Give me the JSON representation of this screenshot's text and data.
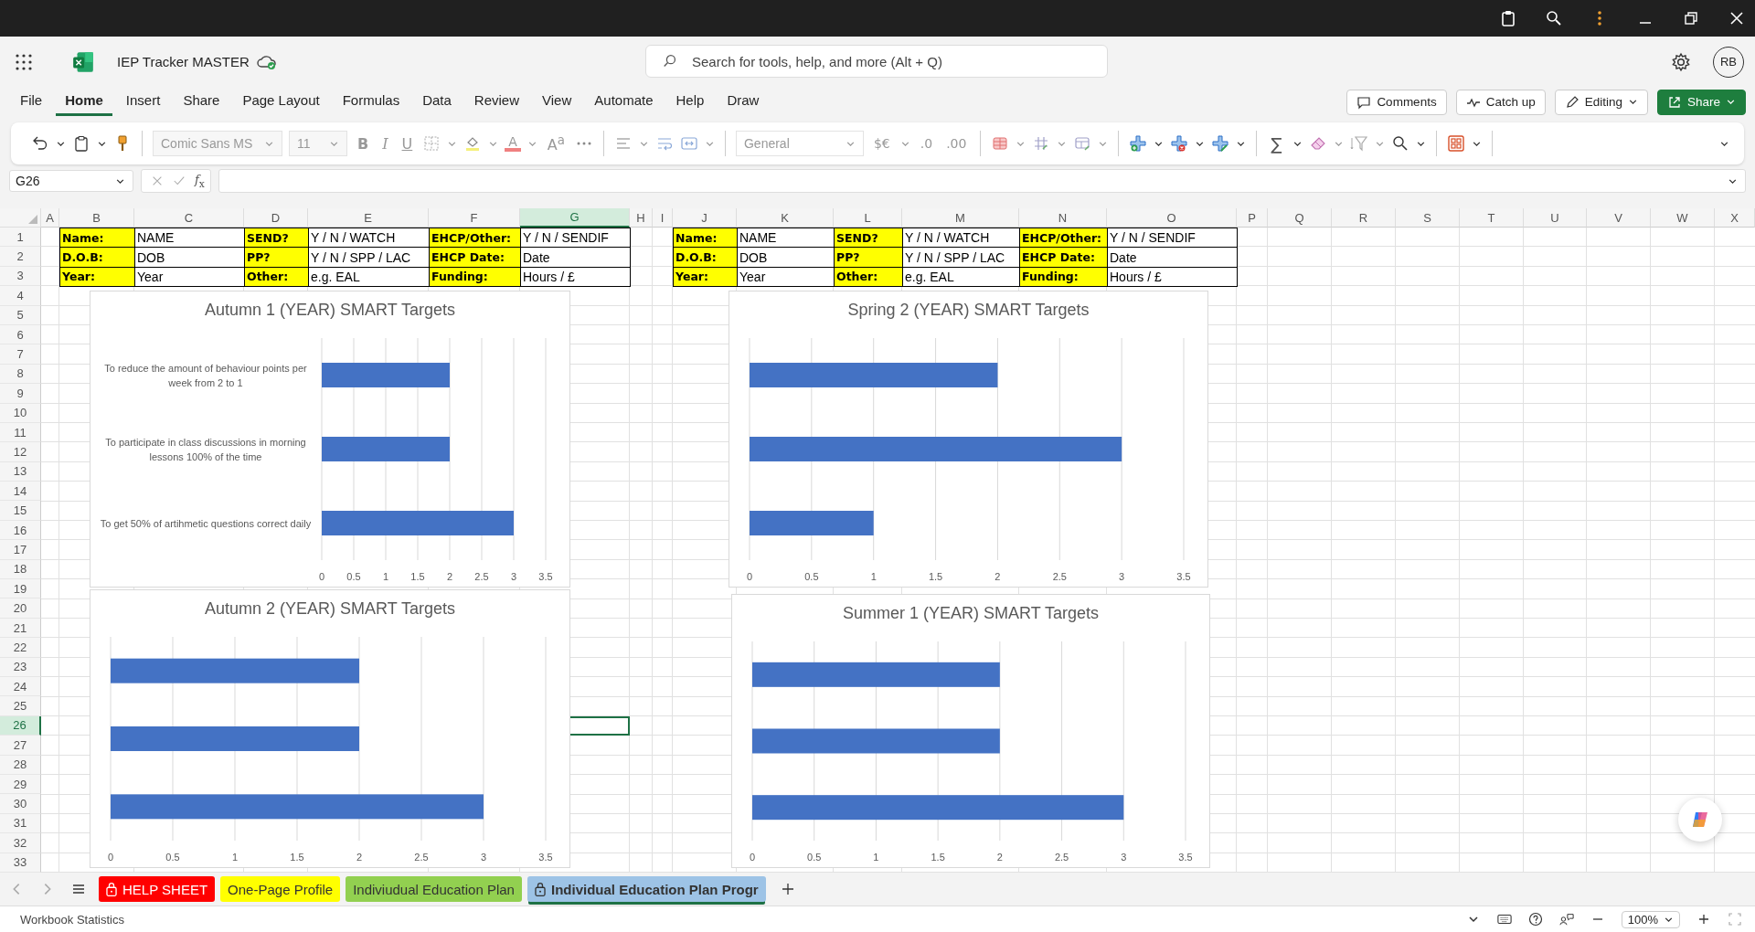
{
  "app": {
    "title": "IEP Tracker MASTER",
    "search": {
      "placeholder": "Search for tools, help, and more (Alt + Q)"
    },
    "avatar": "RB"
  },
  "menu_tabs": [
    {
      "label": "File",
      "selected": false
    },
    {
      "label": "Home",
      "selected": true
    },
    {
      "label": "Insert",
      "selected": false
    },
    {
      "label": "Share",
      "selected": false
    },
    {
      "label": "Page Layout",
      "selected": false
    },
    {
      "label": "Formulas",
      "selected": false
    },
    {
      "label": "Data",
      "selected": false
    },
    {
      "label": "Review",
      "selected": false
    },
    {
      "label": "View",
      "selected": false
    },
    {
      "label": "Automate",
      "selected": false
    },
    {
      "label": "Help",
      "selected": false
    },
    {
      "label": "Draw",
      "selected": false
    }
  ],
  "actions": [
    {
      "label": "Comments",
      "kind": "comments"
    },
    {
      "label": "Catch up",
      "kind": "catchup"
    },
    {
      "label": "Editing",
      "kind": "editing"
    },
    {
      "label": "Share",
      "kind": "share"
    }
  ],
  "ribbon": {
    "font": "Comic Sans MS",
    "size": "11",
    "bold": "B",
    "italic": "I",
    "underline": "U",
    "font_color": "A",
    "grow_font": "A$^{a}$",
    "number_format": "General",
    "currency": "$€",
    "decrease_decimal": ".0",
    "increase_decimal": ".00",
    "sum": "∑"
  },
  "formula_bar": {
    "name_box": "G26",
    "fx": "*f*$_{x}$"
  },
  "columns": [
    {
      "label": "A",
      "selected": false
    },
    {
      "label": "B",
      "selected": false
    },
    {
      "label": "C",
      "selected": false
    },
    {
      "label": "D",
      "selected": false
    },
    {
      "label": "E",
      "selected": false
    },
    {
      "label": "F",
      "selected": false
    },
    {
      "label": "G",
      "selected": true
    },
    {
      "label": "H",
      "selected": false
    },
    {
      "label": "I",
      "selected": false
    },
    {
      "label": "J",
      "selected": false
    },
    {
      "label": "K",
      "selected": false
    },
    {
      "label": "L",
      "selected": false
    },
    {
      "label": "M",
      "selected": false
    },
    {
      "label": "N",
      "selected": false
    },
    {
      "label": "O",
      "selected": false
    },
    {
      "label": "P",
      "selected": false
    },
    {
      "label": "Q",
      "selected": false
    },
    {
      "label": "R",
      "selected": false
    },
    {
      "label": "S",
      "selected": false
    },
    {
      "label": "T",
      "selected": false
    },
    {
      "label": "U",
      "selected": false
    },
    {
      "label": "V",
      "selected": false
    },
    {
      "label": "W",
      "selected": false
    },
    {
      "label": "X",
      "selected": false
    }
  ],
  "rows": [
    {
      "label": "1",
      "selected": false
    },
    {
      "label": "2",
      "selected": false
    },
    {
      "label": "3",
      "selected": false
    },
    {
      "label": "4",
      "selected": false
    },
    {
      "label": "5",
      "selected": false
    },
    {
      "label": "6",
      "selected": false
    },
    {
      "label": "7",
      "selected": false
    },
    {
      "label": "8",
      "selected": false
    },
    {
      "label": "9",
      "selected": false
    },
    {
      "label": "10",
      "selected": false
    },
    {
      "label": "11",
      "selected": false
    },
    {
      "label": "12",
      "selected": false
    },
    {
      "label": "13",
      "selected": false
    },
    {
      "label": "14",
      "selected": false
    },
    {
      "label": "15",
      "selected": false
    },
    {
      "label": "16",
      "selected": false
    },
    {
      "label": "17",
      "selected": false
    },
    {
      "label": "18",
      "selected": false
    },
    {
      "label": "19",
      "selected": false
    },
    {
      "label": "20",
      "selected": false
    },
    {
      "label": "21",
      "selected": false
    },
    {
      "label": "22",
      "selected": false
    },
    {
      "label": "23",
      "selected": false
    },
    {
      "label": "24",
      "selected": false
    },
    {
      "label": "25",
      "selected": false
    },
    {
      "label": "26",
      "selected": true
    },
    {
      "label": "27",
      "selected": false
    },
    {
      "label": "28",
      "selected": false
    },
    {
      "label": "29",
      "selected": false
    },
    {
      "label": "30",
      "selected": false
    },
    {
      "label": "31",
      "selected": false
    },
    {
      "label": "32",
      "selected": false
    },
    {
      "label": "33",
      "selected": false
    }
  ],
  "info_tables": [
    {
      "rows": [
        [
          {
            "text": "Name:",
            "kind": "label"
          },
          {
            "text": "NAME",
            "kind": "value"
          },
          {
            "text": "SEND?",
            "kind": "label"
          },
          {
            "text": "Y / N / WATCH",
            "kind": "value"
          },
          {
            "text": "EHCP/Other:",
            "kind": "label"
          },
          {
            "text": "Y / N / SENDIF",
            "kind": "value"
          }
        ],
        [
          {
            "text": "D.O.B:",
            "kind": "label"
          },
          {
            "text": "DOB",
            "kind": "value"
          },
          {
            "text": "PP?",
            "kind": "label"
          },
          {
            "text": "Y / N / SPP / LAC",
            "kind": "value"
          },
          {
            "text": "EHCP Date:",
            "kind": "label"
          },
          {
            "text": "Date",
            "kind": "value"
          }
        ],
        [
          {
            "text": "Year:",
            "kind": "label"
          },
          {
            "text": "Year",
            "kind": "value"
          },
          {
            "text": "Other:",
            "kind": "label"
          },
          {
            "text": "e.g. EAL",
            "kind": "value"
          },
          {
            "text": "Funding:",
            "kind": "label"
          },
          {
            "text": "Hours / £",
            "kind": "value"
          }
        ]
      ]
    },
    {
      "rows": [
        [
          {
            "text": "Name:",
            "kind": "label"
          },
          {
            "text": "NAME",
            "kind": "value"
          },
          {
            "text": "SEND?",
            "kind": "label"
          },
          {
            "text": "Y / N / WATCH",
            "kind": "value"
          },
          {
            "text": "EHCP/Other:",
            "kind": "label"
          },
          {
            "text": "Y / N / SENDIF",
            "kind": "value"
          }
        ],
        [
          {
            "text": "D.O.B:",
            "kind": "label"
          },
          {
            "text": "DOB",
            "kind": "value"
          },
          {
            "text": "PP?",
            "kind": "label"
          },
          {
            "text": "Y / N / SPP / LAC",
            "kind": "value"
          },
          {
            "text": "EHCP Date:",
            "kind": "label"
          },
          {
            "text": "Date",
            "kind": "value"
          }
        ],
        [
          {
            "text": "Year:",
            "kind": "label"
          },
          {
            "text": "Year",
            "kind": "value"
          },
          {
            "text": "Other:",
            "kind": "label"
          },
          {
            "text": "e.g. EAL",
            "kind": "value"
          },
          {
            "text": "Funding:",
            "kind": "label"
          },
          {
            "text": "Hours / £",
            "kind": "value"
          }
        ]
      ]
    }
  ],
  "charts": [
    {
      "chart_data": {
        "type": "bar",
        "orientation": "horizontal",
        "title": "Autumn 1 (YEAR) SMART Targets",
        "categories": [
          "To reduce the amount of behaviour points per week from 2 to 1",
          "To participate in class discussions in morning lessons 100% of the time",
          "To get 50% of artihmetic questions correct daily"
        ],
        "values": [
          2,
          2,
          3
        ],
        "xlim": [
          0,
          3.5
        ],
        "xticks": [
          0,
          0.5,
          1,
          1.5,
          2,
          2.5,
          3,
          3.5
        ],
        "grid": true
      }
    },
    {
      "chart_data": {
        "type": "bar",
        "orientation": "horizontal",
        "title": "Spring 2 (YEAR) SMART Targets",
        "values": [
          2,
          3,
          1
        ],
        "xlim": [
          0,
          3.5
        ],
        "xticks": [
          0,
          0.5,
          1,
          1.5,
          2,
          2.5,
          3,
          3.5
        ],
        "grid": true
      }
    },
    {
      "chart_data": {
        "type": "bar",
        "orientation": "horizontal",
        "title": "Autumn 2 (YEAR) SMART Targets",
        "values": [
          2,
          2,
          3
        ],
        "xlim": [
          0,
          3.5
        ],
        "xticks": [
          0,
          0.5,
          1,
          1.5,
          2,
          2.5,
          3,
          3.5
        ],
        "grid": true
      }
    },
    {
      "chart_data": {
        "type": "bar",
        "orientation": "horizontal",
        "title": "Summer 1 (YEAR) SMART Targets",
        "values": [
          2,
          2,
          3
        ],
        "xlim": [
          0,
          3.5
        ],
        "xticks": [
          0,
          0.5,
          1,
          1.5,
          2,
          2.5,
          3,
          3.5
        ],
        "grid": true
      }
    }
  ],
  "sheet_tabs": [
    {
      "label": "HELP SHEET",
      "color": "#ff0000",
      "locked": true,
      "selected": false
    },
    {
      "label": "One-Page Profile",
      "color": "#ffff00",
      "locked": false,
      "selected": false
    },
    {
      "label": "Indiviudual Education Plan",
      "color": "#92d050",
      "locked": false,
      "selected": false
    },
    {
      "label": "Individual Education Plan Progr",
      "color": "#9dc3e6",
      "locked": true,
      "selected": true
    }
  ],
  "status_bar": {
    "text": "Workbook Statistics",
    "zoom": "100%"
  }
}
